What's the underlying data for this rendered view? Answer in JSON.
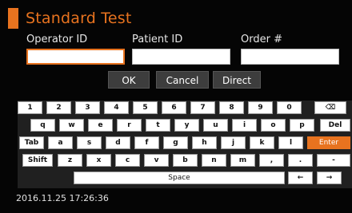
{
  "title": "Standard Test",
  "fields": [
    {
      "label": "Operator ID",
      "value": ""
    },
    {
      "label": "Patient ID",
      "value": ""
    },
    {
      "label": "Order #",
      "value": ""
    }
  ],
  "buttons": {
    "ok": "OK",
    "cancel": "Cancel",
    "direct": "Direct"
  },
  "keyboard": {
    "row1": [
      "1",
      "2",
      "3",
      "4",
      "5",
      "6",
      "7",
      "8",
      "9",
      "0",
      "⌫"
    ],
    "row2": [
      "q",
      "w",
      "e",
      "r",
      "t",
      "y",
      "u",
      "i",
      "o",
      "p",
      "Del"
    ],
    "row3": [
      "Tab",
      "a",
      "s",
      "d",
      "f",
      "g",
      "h",
      "j",
      "k",
      "l",
      "Enter"
    ],
    "row4": [
      "Shift",
      "z",
      "x",
      "c",
      "v",
      "b",
      "n",
      "m",
      ",",
      ".",
      "-"
    ],
    "row5": [
      "Space",
      "←",
      "→"
    ]
  },
  "status": {
    "datetime": "2016.11.25  17:26:36"
  },
  "colors": {
    "accent": "#e8731f",
    "background": "#050505"
  }
}
